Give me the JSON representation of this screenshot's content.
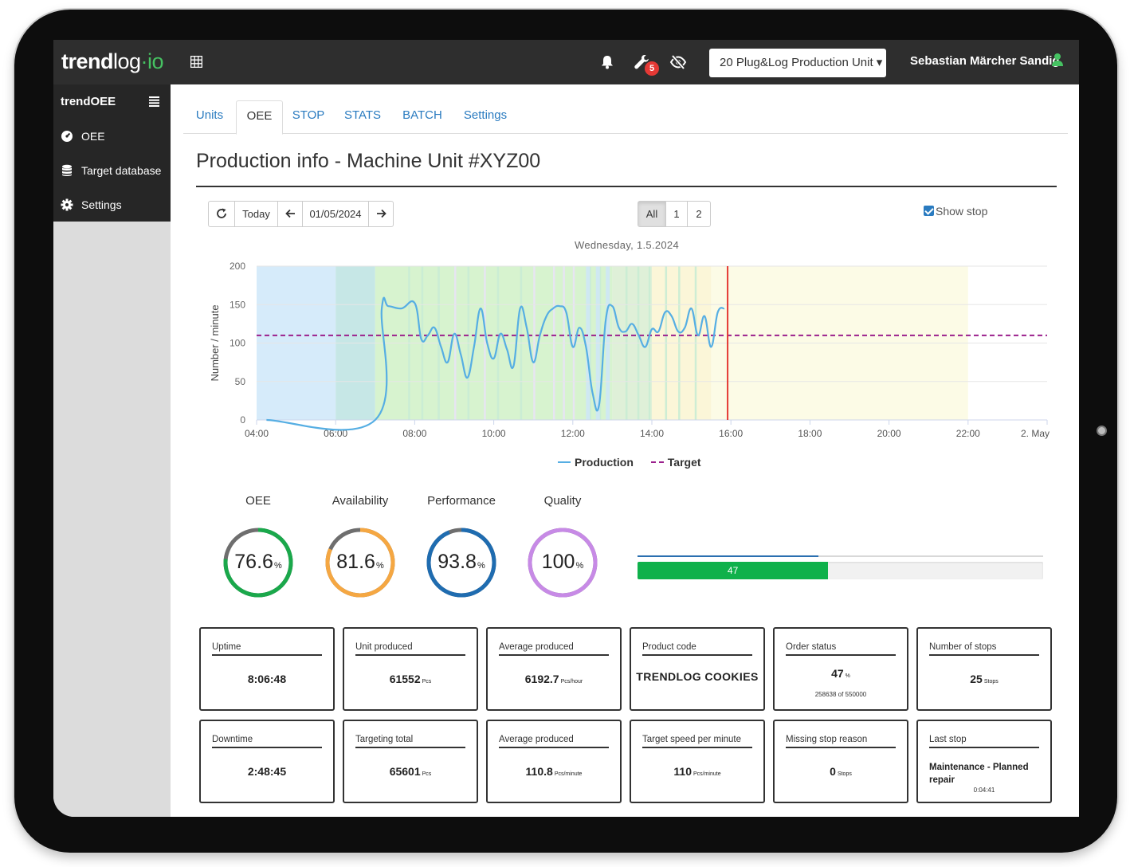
{
  "brand": {
    "part1": "trend",
    "part2": "log",
    "part3": "·io"
  },
  "topbar": {
    "notifications_badge": "5",
    "unit_selector": "20 Plug&Log Production Unit ▾",
    "user_name": "Sebastian Märcher Sandig"
  },
  "sidebar": {
    "title_bold": "trend",
    "title_rest": "OEE",
    "items": [
      {
        "label": "OEE",
        "icon": "dashboard-icon"
      },
      {
        "label": "Target database",
        "icon": "database-icon"
      },
      {
        "label": "Settings",
        "icon": "gear-icon"
      }
    ]
  },
  "tabs": [
    "Units",
    "OEE",
    "STOP",
    "STATS",
    "BATCH",
    "Settings"
  ],
  "active_tab": "OEE",
  "page": {
    "title": "Production info - Machine Unit #XYZ00"
  },
  "toolbar": {
    "today": "Today",
    "date": "01/05/2024",
    "shifts": [
      "All",
      "1",
      "2"
    ],
    "show_stop": "Show stop",
    "show_stop_checked": true
  },
  "colors": {
    "accent": "#2a7bc0",
    "green": "#0fb14b",
    "orange": "#f5a742",
    "blue_dark": "#1f6cb0",
    "purple": "#c78ae6",
    "target": "#9b1f8c",
    "now_line": "#e53935"
  },
  "chart_data": {
    "type": "line",
    "title": "Wednesday, 1.5.2024",
    "xlabel": "",
    "ylabel": "Number / minute",
    "ylim": [
      0,
      200
    ],
    "yticks": [
      0,
      50,
      100,
      150,
      200
    ],
    "xlim": [
      "04:00",
      "2. May 00:00"
    ],
    "xticks": [
      "04:00",
      "06:00",
      "08:00",
      "10:00",
      "12:00",
      "14:00",
      "16:00",
      "18:00",
      "20:00",
      "22:00",
      "2. May"
    ],
    "legend": [
      "Production",
      "Target"
    ],
    "legend_position": "bottom",
    "series": [
      {
        "name": "Production",
        "color": "#56aee3",
        "x": [
          "04:15",
          "07:00",
          "07:10",
          "07:20",
          "07:40",
          "08:00",
          "08:10",
          "08:20",
          "08:30",
          "08:40",
          "08:50",
          "09:00",
          "09:10",
          "09:20",
          "09:30",
          "09:40",
          "09:50",
          "10:00",
          "10:10",
          "10:20",
          "10:30",
          "10:40",
          "10:50",
          "11:00",
          "11:10",
          "11:20",
          "11:30",
          "11:40",
          "11:50",
          "12:00",
          "12:10",
          "12:20",
          "12:30",
          "12:40",
          "12:50",
          "13:00",
          "13:10",
          "13:20",
          "13:30",
          "13:40",
          "13:50",
          "14:00",
          "14:10",
          "14:20",
          "14:30",
          "14:40",
          "14:50",
          "15:00",
          "15:10",
          "15:20",
          "15:30",
          "15:40",
          "15:50"
        ],
        "y": [
          0,
          0,
          145,
          148,
          145,
          152,
          105,
          110,
          120,
          95,
          75,
          112,
          85,
          55,
          95,
          145,
          100,
          80,
          112,
          92,
          70,
          145,
          120,
          75,
          110,
          135,
          145,
          148,
          140,
          95,
          120,
          95,
          35,
          20,
          130,
          148,
          120,
          115,
          125,
          110,
          95,
          118,
          115,
          140,
          135,
          115,
          120,
          145,
          110,
          135,
          95,
          140,
          145
        ]
      },
      {
        "name": "Target",
        "color": "#9b1f8c",
        "style": "dashed",
        "x": [
          "04:00",
          "2. May 00:00"
        ],
        "y": [
          110,
          110
        ]
      }
    ],
    "background_bands": [
      {
        "from": "04:00",
        "to": "06:00",
        "state": "no-shift",
        "color": "#d6ebfa"
      },
      {
        "from": "06:00",
        "to": "07:00",
        "state": "stop",
        "color": "#c6e7e6"
      },
      {
        "from": "07:00",
        "to": "13:00",
        "state": "running",
        "color": "#d7f3cf"
      },
      {
        "from": "13:00",
        "to": "14:00",
        "state": "mixed",
        "color": "#dff0d8"
      },
      {
        "from": "14:00",
        "to": "15:30",
        "state": "warning",
        "color": "#fbf6d8"
      },
      {
        "from": "15:30",
        "to": "22:00",
        "state": "planned",
        "color": "#fcfbe6"
      }
    ],
    "now_marker": "15:55"
  },
  "gauges": [
    {
      "title": "OEE",
      "value": "76.6",
      "unit": "%",
      "fraction": 0.766,
      "color": "#1aa84b"
    },
    {
      "title": "Availability",
      "value": "81.6",
      "unit": "%",
      "fraction": 0.816,
      "color": "#f5a742"
    },
    {
      "title": "Performance",
      "value": "93.8",
      "unit": "%",
      "fraction": 0.938,
      "color": "#1f6cb0"
    },
    {
      "title": "Quality",
      "value": "100",
      "unit": "%",
      "fraction": 1.0,
      "color": "#c78ae6"
    }
  ],
  "progress": {
    "thin_fraction": 0.445,
    "bar_fraction": 0.47,
    "label": "47"
  },
  "cards_top": [
    {
      "title": "Uptime",
      "value": "8:06:48",
      "unit": ""
    },
    {
      "title": "Unit produced",
      "value": "61552",
      "unit": "Pcs"
    },
    {
      "title": "Average produced",
      "value": "6192.7",
      "unit": "Pcs/hour"
    },
    {
      "title": "Product code",
      "value": "TRENDLOG COOKIES",
      "unit": ""
    },
    {
      "title": "Order status",
      "value": "47",
      "unit": "%",
      "sub": "258638 of 550000"
    },
    {
      "title": "Number of stops",
      "value": "25",
      "unit": "Stops"
    }
  ],
  "cards_bottom": [
    {
      "title": "Downtime",
      "value": "2:48:45",
      "unit": ""
    },
    {
      "title": "Targeting total",
      "value": "65601",
      "unit": "Pcs"
    },
    {
      "title": "Average produced",
      "value": "110.8",
      "unit": "Pcs/minute"
    },
    {
      "title": "Target speed per minute",
      "value": "110",
      "unit": "Pcs/minute"
    },
    {
      "title": "Missing stop reason",
      "value": "0",
      "unit": "Stops"
    },
    {
      "title": "Last stop",
      "value": "Maintenance - Planned repair",
      "unit": "",
      "sub": "0:04:41"
    }
  ]
}
